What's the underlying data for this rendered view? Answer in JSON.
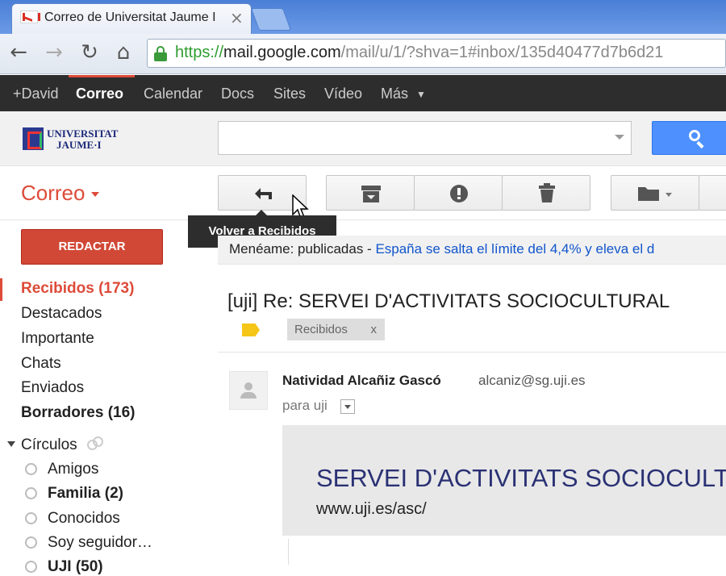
{
  "browser": {
    "tab_title": "Correo de Universitat Jaume I",
    "tab_close": "×",
    "url_scheme": "https://",
    "url_host": "mail.google.com",
    "url_path": "/mail/u/1/?shva=1#inbox/135d40477d7b6d21"
  },
  "gbar": {
    "items": [
      "+David",
      "Correo",
      "Calendar",
      "Docs",
      "Sites",
      "Vídeo",
      "Más"
    ],
    "active": "Correo",
    "accent": "#dd4b39"
  },
  "header": {
    "logo_line1": "UNIVERSITAT",
    "logo_line2": "JAUME·I",
    "search_placeholder": ""
  },
  "sidebar": {
    "title": "Correo",
    "compose": "REDACTAR",
    "items": [
      {
        "label": "Recibidos (173)",
        "state": "active"
      },
      {
        "label": "Destacados",
        "state": "normal"
      },
      {
        "label": "Importante",
        "state": "normal"
      },
      {
        "label": "Chats",
        "state": "normal"
      },
      {
        "label": "Enviados",
        "state": "normal"
      },
      {
        "label": "Borradores (16)",
        "state": "bold"
      }
    ],
    "circles_label": "Círculos",
    "circles": [
      {
        "label": "Amigos",
        "bold": false
      },
      {
        "label": "Familia (2)",
        "bold": true
      },
      {
        "label": "Conocidos",
        "bold": false
      },
      {
        "label": "Soy seguidor…",
        "bold": false
      },
      {
        "label": "UJI (50)",
        "bold": true
      }
    ]
  },
  "toolbar": {
    "tooltip": "Volver a Recibidos",
    "buttons": [
      "back-to-inbox",
      "archive",
      "report-spam",
      "delete",
      "move-to"
    ]
  },
  "webclip": {
    "source": "Menéame: publicadas - ",
    "link": "España se salta el límite del 4,4% y eleva el d"
  },
  "message": {
    "subject": "[uji] Re: SERVEI D'ACTIVITATS SOCIOCULTURAL",
    "label": "Recibidos",
    "label_remove": "x",
    "sender_name": "Natividad Alcañiz Gascó",
    "sender_email": "alcaniz@sg.uji.es",
    "to": "para uji",
    "banner_title": "SERVEI D'ACTIVITATS SOCIOCULTU",
    "banner_url": "www.uji.es/asc/"
  }
}
